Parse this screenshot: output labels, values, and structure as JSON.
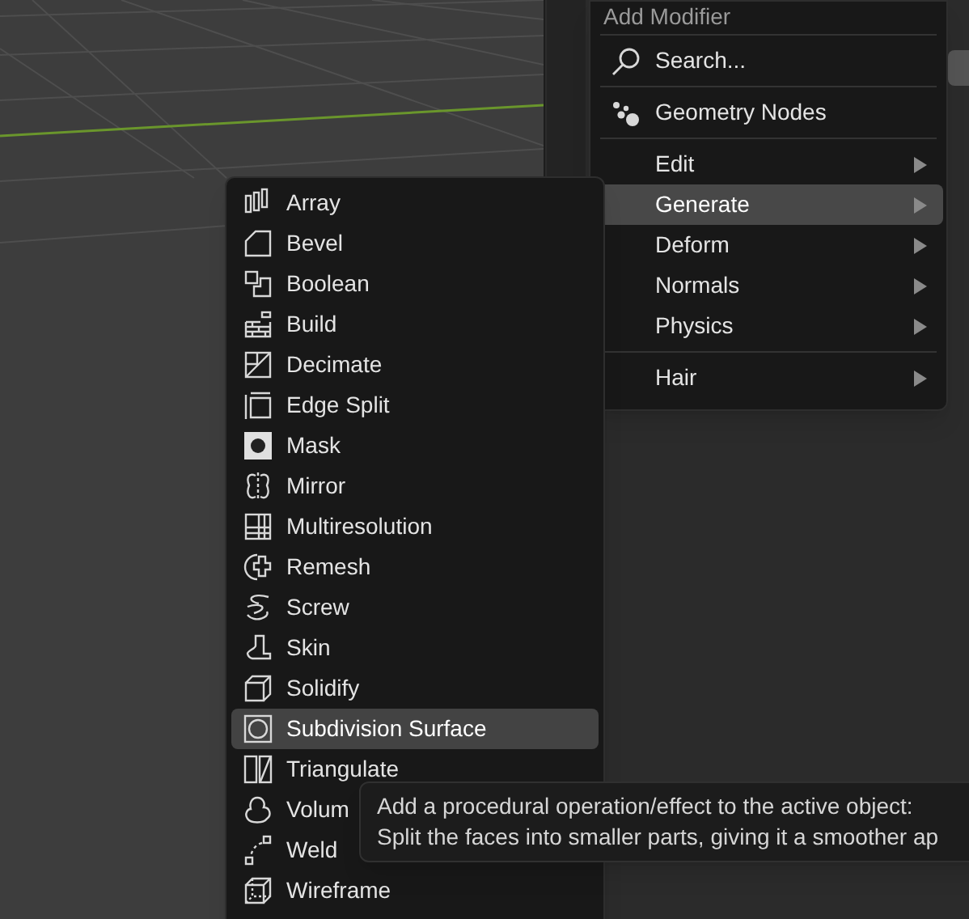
{
  "add_modifier_menu": {
    "title": "Add Modifier",
    "sections": [
      {
        "items": [
          {
            "kind": "search",
            "label": "Search...",
            "selected": false
          }
        ]
      },
      {
        "items": [
          {
            "kind": "nodes",
            "label": "Geometry Nodes",
            "selected": false
          }
        ]
      },
      {
        "items": [
          {
            "kind": "submenu",
            "label": "Edit",
            "selected": false
          },
          {
            "kind": "submenu",
            "label": "Generate",
            "selected": true
          },
          {
            "kind": "submenu",
            "label": "Deform",
            "selected": false
          },
          {
            "kind": "submenu",
            "label": "Normals",
            "selected": false
          },
          {
            "kind": "submenu",
            "label": "Physics",
            "selected": false
          }
        ]
      },
      {
        "items": [
          {
            "kind": "submenu",
            "label": "Hair",
            "selected": false
          }
        ]
      }
    ]
  },
  "generate_menu": {
    "items": [
      {
        "label": "Array",
        "selected": false
      },
      {
        "label": "Bevel",
        "selected": false
      },
      {
        "label": "Boolean",
        "selected": false
      },
      {
        "label": "Build",
        "selected": false
      },
      {
        "label": "Decimate",
        "selected": false
      },
      {
        "label": "Edge Split",
        "selected": false
      },
      {
        "label": "Mask",
        "selected": false
      },
      {
        "label": "Mirror",
        "selected": false
      },
      {
        "label": "Multiresolution",
        "selected": false
      },
      {
        "label": "Remesh",
        "selected": false
      },
      {
        "label": "Screw",
        "selected": false
      },
      {
        "label": "Skin",
        "selected": false
      },
      {
        "label": "Solidify",
        "selected": false
      },
      {
        "label": "Subdivision Surface",
        "selected": true
      },
      {
        "label": "Triangulate",
        "selected": false
      },
      {
        "label": "Volum",
        "selected": false
      },
      {
        "label": "Weld",
        "selected": false
      },
      {
        "label": "Wireframe",
        "selected": false
      }
    ]
  },
  "tooltip": {
    "lines": [
      "Add a procedural operation/effect to the active object:",
      "Split the faces into smaller parts, giving it a smoother ap"
    ]
  }
}
